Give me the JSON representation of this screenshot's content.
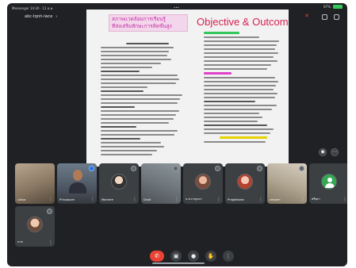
{
  "statusbar": {
    "left": "Messenger 14:30 · 11 ต.ค.",
    "center": "•••",
    "battery": "87%"
  },
  "meeting": {
    "name": "abc-tqnh-iwce",
    "chevron": "›"
  },
  "slide": {
    "thai_line1": "สภาพแวดล้อมการเรียนรู้",
    "thai_line2": "ที่ส่งเสริมทักษะการคิดขั้นสูง",
    "title": "Objective & Outcomes"
  },
  "participants": [
    {
      "name": "Lalisa",
      "style": "video-a"
    },
    {
      "name": "Prinyaporn",
      "style": "video-b",
      "active": true
    },
    {
      "name": "Montree",
      "style": "avatar",
      "avatar": "av1"
    },
    {
      "name": "Dusit",
      "style": "video-c"
    },
    {
      "name": "น.ส.กาญจนา",
      "style": "avatar",
      "avatar": "av2"
    },
    {
      "name": "Pragaikaew",
      "style": "avatar",
      "avatar": "av3"
    },
    {
      "name": "siriporn",
      "style": "video-d"
    },
    {
      "name": "ศรีสุดา",
      "style": "avatar",
      "avatar": "av-green"
    },
    {
      "name": "นวล",
      "style": "avatar",
      "avatar": "av4"
    }
  ],
  "controls": {
    "hangup_icon": "phone-hangup-icon",
    "video_icon": "camera-icon",
    "mic_icon": "mic-icon",
    "hand_icon": "hand-icon",
    "more_icon": "more-icon"
  },
  "colors": {
    "background": "#202124",
    "tile": "#3c4043",
    "hangup": "#ea4335",
    "slide_title": "#d61f52"
  }
}
